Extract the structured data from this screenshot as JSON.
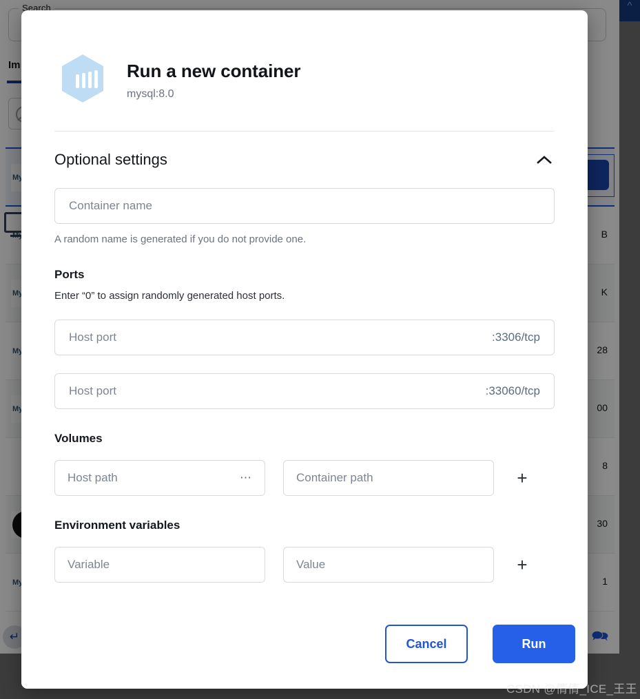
{
  "background": {
    "search": {
      "legend": "Search",
      "value": ""
    },
    "tabs": [
      {
        "label": "Im",
        "active": true
      }
    ],
    "filter_icon": "no-internet-globe-icon",
    "pull_button_label": "",
    "rows": [
      {
        "logo": "mysql",
        "size": ""
      },
      {
        "logo": "mysql",
        "size": "B"
      },
      {
        "logo": "mysql",
        "size": "K"
      },
      {
        "logo": "mysql",
        "size": "28"
      },
      {
        "logo": "mysql",
        "size": "00"
      },
      {
        "logo": "bitnami",
        "size": "8"
      },
      {
        "logo": "dark-circle",
        "size": "30"
      },
      {
        "logo": "mysql",
        "size": "1"
      }
    ],
    "bottom_left_icon": "return-arrow-icon",
    "bottom_right_icon": "chat-feedback-icon",
    "titlebar_icon": "chevron-up-icon"
  },
  "modal": {
    "icon": "container-hexagon-icon",
    "title": "Run a new container",
    "subtitle": "mysql:8.0",
    "optional_settings": {
      "heading": "Optional settings",
      "collapse_icon": "chevron-up-icon",
      "container_name": {
        "placeholder": "Container name",
        "value": "",
        "helper": "A random name is generated if you do not provide one."
      },
      "ports": {
        "title": "Ports",
        "note": "Enter “0” to assign randomly generated host ports.",
        "rows": [
          {
            "placeholder": "Host port",
            "value": "",
            "suffix": ":3306/tcp"
          },
          {
            "placeholder": "Host port",
            "value": "",
            "suffix": ":33060/tcp"
          }
        ]
      },
      "volumes": {
        "title": "Volumes",
        "host_path_placeholder": "Host path",
        "host_path_value": "",
        "browse_icon": "ellipsis-icon",
        "container_path_placeholder": "Container path",
        "container_path_value": "",
        "add_icon": "plus-icon"
      },
      "env_vars": {
        "title": "Environment variables",
        "variable_placeholder": "Variable",
        "variable_value": "",
        "value_placeholder": "Value",
        "value_value": "",
        "add_icon": "plus-icon"
      }
    },
    "footer": {
      "cancel_label": "Cancel",
      "run_label": "Run"
    }
  },
  "watermark": "CSDN @倩倩_ICE_王王",
  "colors": {
    "primary": "#2660e8",
    "primary_outline": "#2354d6",
    "tab_underline": "#1a3c8c",
    "hexagon": "#bfdcf5"
  }
}
